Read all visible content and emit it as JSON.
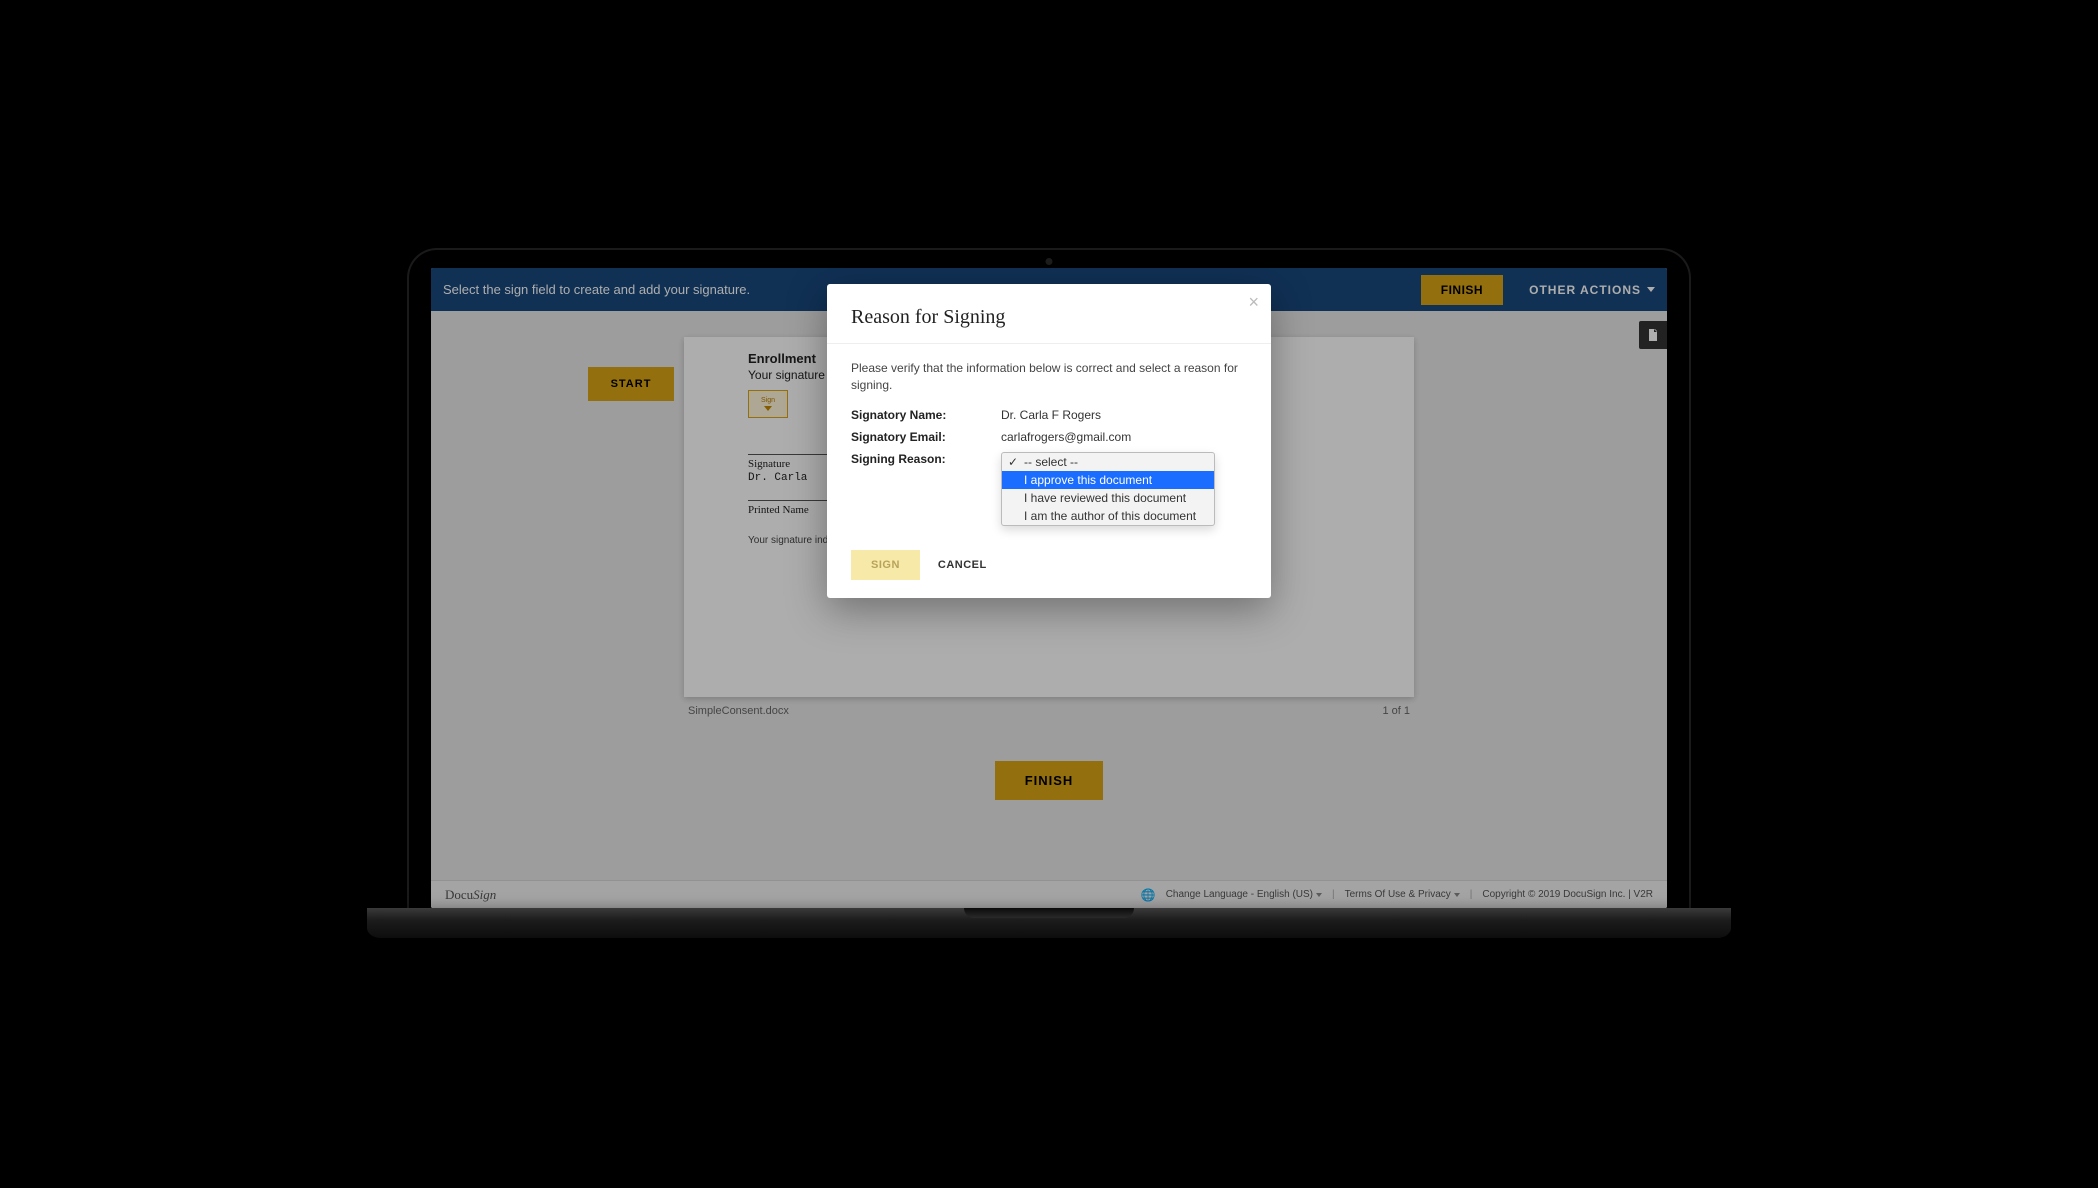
{
  "header": {
    "message": "Select the sign field to create and add your signature.",
    "finish": "FINISH",
    "other_actions": "OTHER ACTIONS"
  },
  "document": {
    "start": "START",
    "title": "Enrollment",
    "sub": "Your signature",
    "sign_tag": "Sign",
    "sig_label": "Signature",
    "printed_line_label": "Printed Name",
    "printed_name_value": "Dr. Carla",
    "disclaimer": "Your signature indicates that you understand what is involved in this research and agree to participate.",
    "filename": "SimpleConsent.docx",
    "page_indicator": "1 of 1",
    "finish_big": "FINISH"
  },
  "footer": {
    "brand_a": "Docu",
    "brand_b": "Sign",
    "language": "Change Language - English (US)",
    "terms": "Terms Of Use & Privacy",
    "copyright": "Copyright © 2019 DocuSign Inc.  |  V2R"
  },
  "modal": {
    "title": "Reason for Signing",
    "instruction": "Please verify that the information below is correct and select a reason for signing.",
    "name_label": "Signatory Name:",
    "name_value": "Dr. Carla F Rogers",
    "email_label": "Signatory Email:",
    "email_value": "carlafrogers@gmail.com",
    "reason_label": "Signing Reason:",
    "options": {
      "o0": "-- select --",
      "o1": "I approve this document",
      "o2": "I have reviewed this document",
      "o3": "I am the author of this document"
    },
    "sign_btn": "SIGN",
    "cancel_btn": "CANCEL"
  }
}
